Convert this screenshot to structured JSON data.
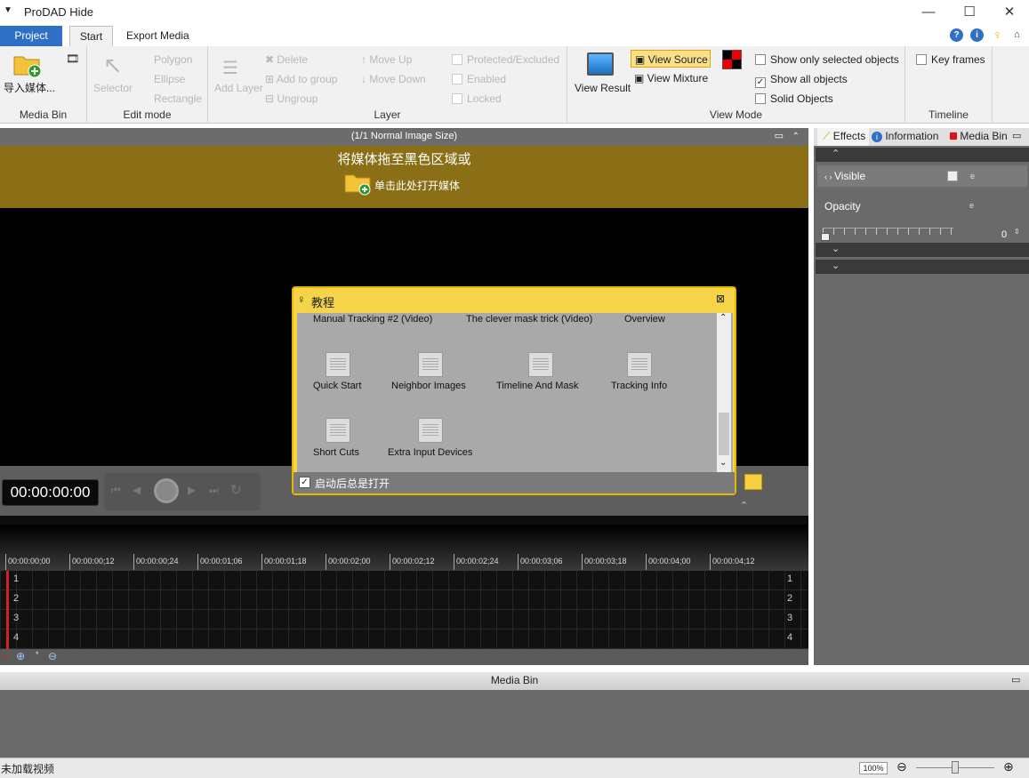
{
  "window": {
    "title": "ProDAD Hide",
    "minimize": "—",
    "maximize": "☐",
    "close": "✕"
  },
  "tabs": {
    "project": "Project",
    "start": "Start",
    "export": "Export Media"
  },
  "ribbon": {
    "media_bin": {
      "import_label": "导入媒体...",
      "group": "Media Bin"
    },
    "edit_mode": {
      "selector": "Selector",
      "polygon": "Polygon",
      "ellipse": "Ellipse",
      "rectangle": "Rectangle",
      "group": "Edit mode"
    },
    "layer": {
      "add_layer": "Add Layer",
      "delete": "Delete",
      "add_to_group": "Add to group",
      "ungroup": "Ungroup",
      "move_up": "Move Up",
      "move_down": "Move Down",
      "protected": "Protected/Excluded",
      "enabled": "Enabled",
      "locked": "Locked",
      "group": "Layer"
    },
    "view_mode": {
      "view_result": "View Result",
      "view_source": "View Source",
      "view_mixture": "View Mixture",
      "show_selected": "Show only selected objects",
      "show_all": "Show all objects",
      "solid": "Solid Objects",
      "group": "View Mode"
    },
    "timeline": {
      "key_frames": "Key frames",
      "group": "Timeline"
    }
  },
  "preview": {
    "header": "(1/1  Normal Image Size)",
    "drop_line1": "将媒体拖至黑色区域或",
    "drop_line2": "单击此处打开媒体",
    "timecode": "00:00:00:00"
  },
  "timeline": {
    "ticks": [
      "00:00:00;00",
      "00:00:00;12",
      "00:00:00;24",
      "00:00:01;06",
      "00:00:01;18",
      "00:00:02;00",
      "00:00:02;12",
      "00:00:02;24",
      "00:00:03;06",
      "00:00:03;18",
      "00:00:04;00",
      "00:00:04;12"
    ],
    "tracks": [
      "1",
      "2",
      "3",
      "4"
    ]
  },
  "right_panel": {
    "tabs": {
      "effects": "Effects",
      "information": "Information",
      "media_bin": "Media Bin"
    },
    "visible": "Visible",
    "opacity": "Opacity",
    "opacity_value": "0"
  },
  "media_bin": {
    "header": "Media Bin"
  },
  "status": {
    "text": "未加载视频",
    "zoom": "100%"
  },
  "tutorial": {
    "title": "教程",
    "top_items": [
      "Manual Tracking #2 (Video)",
      "The clever mask trick (Video)",
      "Overview"
    ],
    "items_row1": [
      "Quick Start",
      "Neighbor Images",
      "Timeline And Mask",
      "Tracking Info"
    ],
    "items_row2": [
      "Short Cuts",
      "Extra Input Devices"
    ],
    "startup_label": "启动后总是打开"
  },
  "colors": {
    "accent": "#2f6fc5",
    "drop_banner": "#8a6f16",
    "dialog": "#f5d44a",
    "playhead": "#d42020"
  }
}
